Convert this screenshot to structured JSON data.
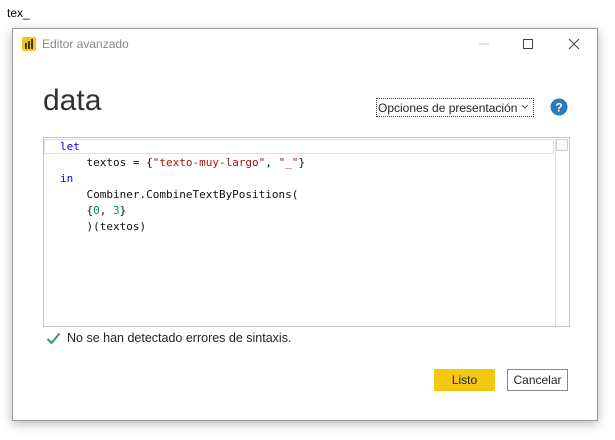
{
  "background": {
    "text": "tex_"
  },
  "window": {
    "title": "Editor avanzado",
    "controls": [
      "minimize-icon",
      "maximize-icon",
      "close-icon"
    ]
  },
  "query": {
    "name": "data"
  },
  "toolbar": {
    "display_options_label": "Opciones de presentación",
    "help_icon": "help-icon"
  },
  "editor": {
    "lines": [
      "let",
      "    textos = {\"texto-muy-largo\", \"_\"}",
      "in",
      "    Combiner.CombineTextByPositions(",
      "    {0, 3}",
      "    )(textos)"
    ]
  },
  "status": {
    "icon": "check-icon",
    "message": "No se han detectado errores de sintaxis."
  },
  "buttons": {
    "done_label": "Listo",
    "cancel_label": "Cancelar"
  },
  "colors": {
    "accent": "#f2c811",
    "check": "#3a9a5b",
    "help": "#2b77c0",
    "keyword": "#0000ff",
    "string": "#a31515",
    "number": "#098658"
  }
}
